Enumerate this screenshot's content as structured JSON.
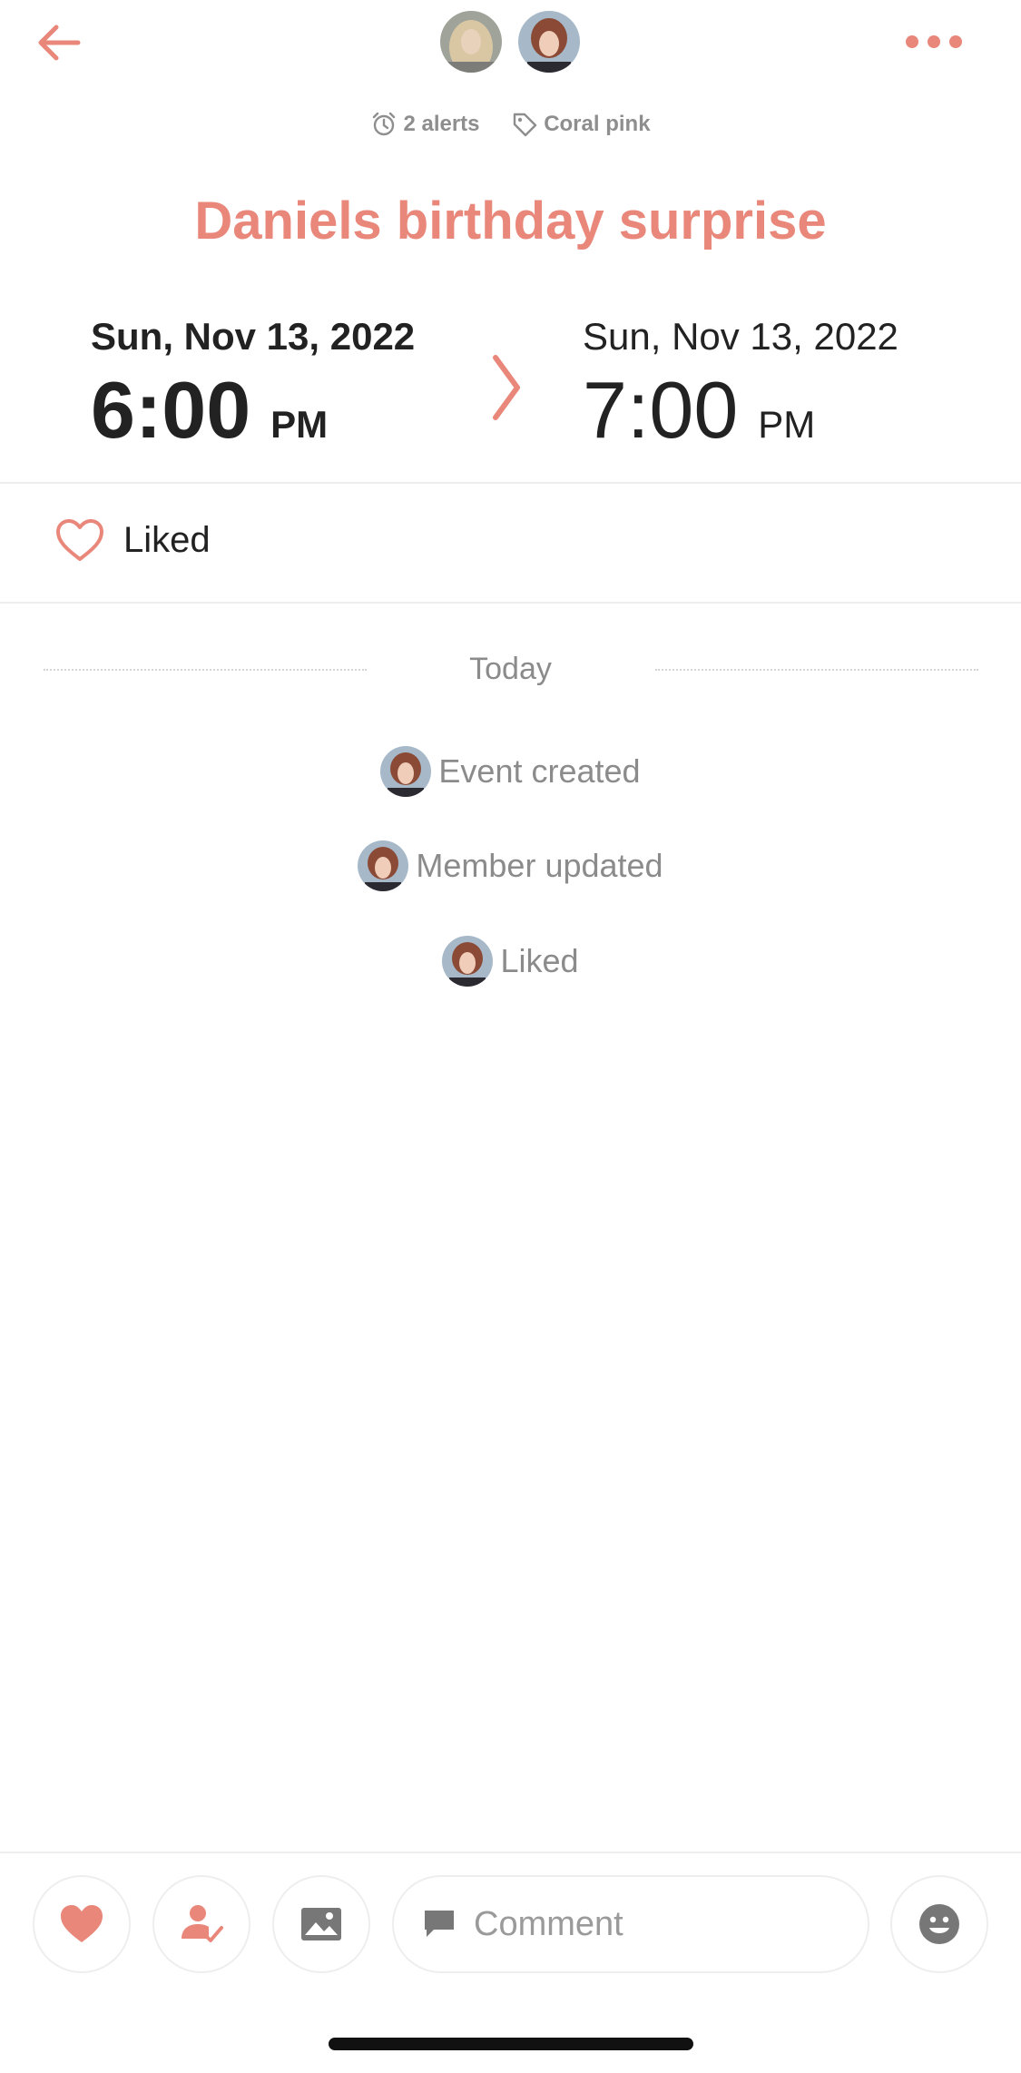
{
  "header": {
    "back_icon": "arrow-left-icon",
    "more_icon": "more-dots-icon",
    "accent_color": "#e8877a"
  },
  "meta": {
    "alerts_label": "2 alerts",
    "color_label": "Coral pink"
  },
  "event": {
    "title": "Daniels birthday surprise",
    "start": {
      "date": "Sun, Nov 13, 2022",
      "time": "6:00",
      "ampm": "PM"
    },
    "end": {
      "date": "Sun, Nov 13, 2022",
      "time": "7:00",
      "ampm": "PM"
    }
  },
  "liked": {
    "label": "Liked"
  },
  "timeline": {
    "section_label": "Today",
    "items": [
      {
        "label": "Event created"
      },
      {
        "label": "Member updated"
      },
      {
        "label": "Liked"
      }
    ]
  },
  "bottom_bar": {
    "comment_placeholder": "Comment"
  }
}
